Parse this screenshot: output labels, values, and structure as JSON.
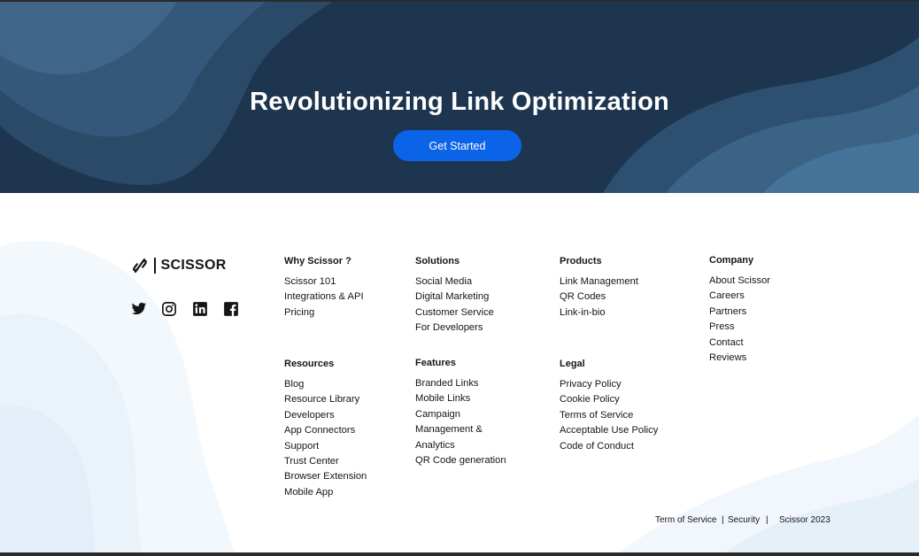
{
  "hero": {
    "title": "Revolutionizing Link Optimization",
    "cta_label": "Get Started",
    "background_color": "#1e3550",
    "button_color": "#0b63e8"
  },
  "brand": {
    "name": "SCISSOR",
    "logo_icon": "scissor-link-icon"
  },
  "social": [
    {
      "name": "twitter-icon"
    },
    {
      "name": "instagram-icon"
    },
    {
      "name": "linkedin-icon"
    },
    {
      "name": "facebook-icon"
    }
  ],
  "footer": {
    "why": {
      "heading": "Why Scissor ?",
      "items": [
        "Scissor 101",
        "Integrations & API",
        "Pricing"
      ]
    },
    "solutions": {
      "heading": "Solutions",
      "items": [
        "Social Media",
        "Digital Marketing",
        "Customer Service",
        "For Developers"
      ]
    },
    "products": {
      "heading": "Products",
      "items": [
        "Link Management",
        "QR Codes",
        "Link-in-bio"
      ]
    },
    "company": {
      "heading": "Company",
      "items": [
        "About Scissor",
        "Careers",
        "Partners",
        "Press",
        "Contact",
        "Reviews"
      ]
    },
    "resources": {
      "heading": "Resources",
      "items": [
        "Blog",
        "Resource Library",
        "Developers",
        "App Connectors",
        "Support",
        "Trust Center",
        "Browser Extension",
        "Mobile App"
      ]
    },
    "features": {
      "heading": "Features",
      "items": [
        "Branded Links",
        "Mobile Links",
        "Campaign",
        "Management &",
        "Analytics",
        "QR Code generation"
      ]
    },
    "legal": {
      "heading": "Legal",
      "items": [
        "Privacy Policy",
        "Cookie Policy",
        "Terms of Service",
        "Acceptable Use Policy",
        "Code of Conduct"
      ]
    }
  },
  "bottom": {
    "terms": "Term of Service",
    "sep1": "|",
    "security": "Security",
    "sep2": "|",
    "copyright": "Scissor 2023"
  }
}
